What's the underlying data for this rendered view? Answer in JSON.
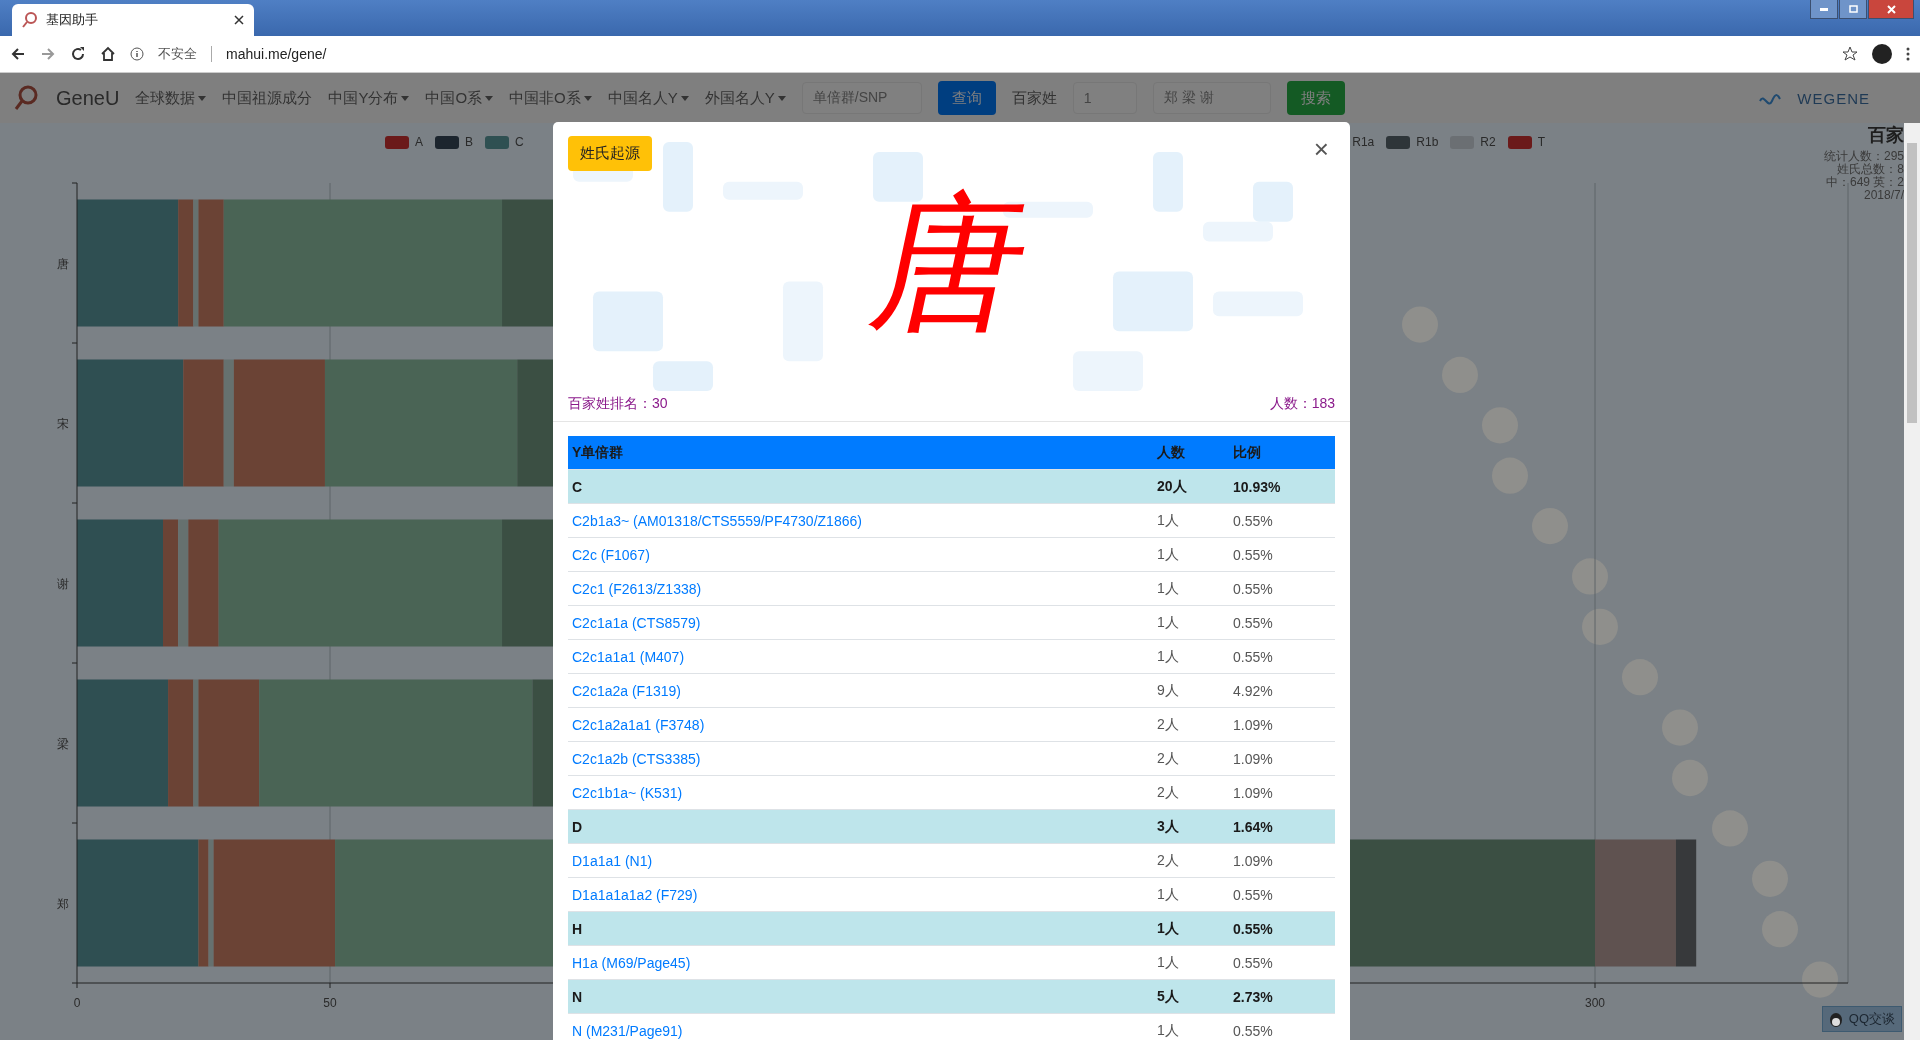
{
  "browser": {
    "tab_title": "基因助手",
    "security": "不安全",
    "url": "mahui.me/gene/"
  },
  "navbar": {
    "brand": "GeneU",
    "menu": [
      {
        "label": "全球数据",
        "dropdown": true
      },
      {
        "label": "中国祖源成分",
        "dropdown": false
      },
      {
        "label": "中国Y分布",
        "dropdown": true
      },
      {
        "label": "中国O系",
        "dropdown": true
      },
      {
        "label": "中国非O系",
        "dropdown": true
      },
      {
        "label": "中国名人Y",
        "dropdown": true
      },
      {
        "label": "外国名人Y",
        "dropdown": true
      }
    ],
    "snp_placeholder": "单倍群/SNP",
    "query_button": "查询",
    "surname_label": "百家姓",
    "surname_select": "1",
    "surname_input": "郑 梁 谢",
    "search_button": "搜索",
    "partner": "WEGENE"
  },
  "legend_left": [
    {
      "label": "A",
      "color": "#6b1a1a"
    },
    {
      "label": "B",
      "color": "#1c252e"
    },
    {
      "label": "C",
      "color": "#2f5052"
    }
  ],
  "legend_right": [
    {
      "label": "R1a"
    },
    {
      "label": "R1b",
      "color": "#2e3539"
    },
    {
      "label": "R2",
      "color": "#6b6f73"
    },
    {
      "label": "T",
      "color": "#6b1a1a"
    }
  ],
  "stats": {
    "title": "百家",
    "lines": [
      "统计人数：295",
      "姓氏总数：8",
      "中：649 英：2",
      "2018/7/"
    ]
  },
  "chart": {
    "categories": [
      "唐",
      "宋",
      "谢",
      "梁",
      "郑"
    ],
    "x_ticks": [
      "0",
      "50",
      "300"
    ]
  },
  "qq_button": "QQ交谈",
  "modal": {
    "origin_button": "姓氏起源",
    "close": "×",
    "surname": "唐",
    "rank": "百家姓排名：30",
    "count": "人数：183",
    "table": {
      "columns": [
        "Y单倍群",
        "人数",
        "比例"
      ],
      "rows": [
        {
          "kind": "group",
          "name": "C",
          "count": "20人",
          "ratio": "10.93%"
        },
        {
          "kind": "link",
          "name": "C2b1a3~ (AM01318/CTS5559/PF4730/Z1866)",
          "count": "1人",
          "ratio": "0.55%"
        },
        {
          "kind": "link",
          "name": "C2c (F1067)",
          "count": "1人",
          "ratio": "0.55%"
        },
        {
          "kind": "link",
          "name": "C2c1 (F2613/Z1338)",
          "count": "1人",
          "ratio": "0.55%"
        },
        {
          "kind": "link",
          "name": "C2c1a1a (CTS8579)",
          "count": "1人",
          "ratio": "0.55%"
        },
        {
          "kind": "link",
          "name": "C2c1a1a1 (M407)",
          "count": "1人",
          "ratio": "0.55%"
        },
        {
          "kind": "link",
          "name": "C2c1a2a (F1319)",
          "count": "9人",
          "ratio": "4.92%"
        },
        {
          "kind": "link",
          "name": "C2c1a2a1a1 (F3748)",
          "count": "2人",
          "ratio": "1.09%"
        },
        {
          "kind": "link",
          "name": "C2c1a2b (CTS3385)",
          "count": "2人",
          "ratio": "1.09%"
        },
        {
          "kind": "link",
          "name": "C2c1b1a~ (K531)",
          "count": "2人",
          "ratio": "1.09%"
        },
        {
          "kind": "group",
          "name": "D",
          "count": "3人",
          "ratio": "1.64%"
        },
        {
          "kind": "link",
          "name": "D1a1a1 (N1)",
          "count": "2人",
          "ratio": "1.09%"
        },
        {
          "kind": "link",
          "name": "D1a1a1a1a2 (F729)",
          "count": "1人",
          "ratio": "0.55%"
        },
        {
          "kind": "group",
          "name": "H",
          "count": "1人",
          "ratio": "0.55%"
        },
        {
          "kind": "link",
          "name": "H1a (M69/Page45)",
          "count": "1人",
          "ratio": "0.55%"
        },
        {
          "kind": "group",
          "name": "N",
          "count": "5人",
          "ratio": "2.73%"
        },
        {
          "kind": "link",
          "name": "N (M231/Page91)",
          "count": "1人",
          "ratio": "0.55%"
        }
      ]
    }
  }
}
